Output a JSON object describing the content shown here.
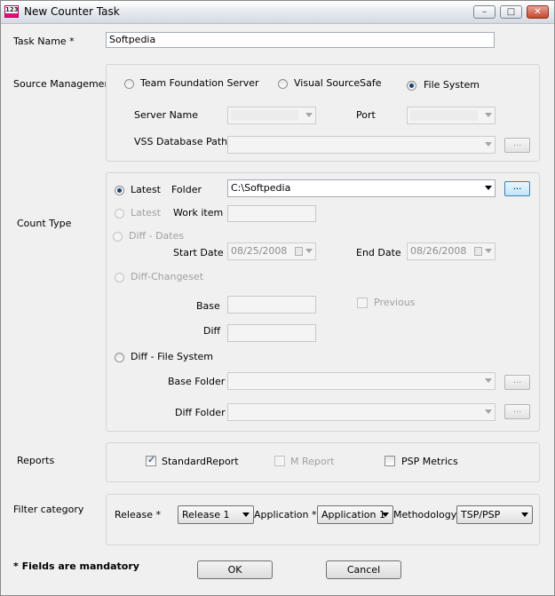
{
  "window": {
    "title": "New Counter Task",
    "icon_text": "123",
    "controls": {
      "minimize": "–",
      "maximize": "□",
      "close": "✕"
    }
  },
  "task_name": {
    "label": "Task Name *",
    "value": "Softpedia"
  },
  "source_management": {
    "label": "Source Management",
    "options": [
      "Team Foundation Server",
      "Visual SourceSafe",
      "File System"
    ],
    "selected": "File System",
    "server_name_label": "Server Name",
    "port_label": "Port",
    "vss_db_path_label": "VSS Database Path",
    "browse_label": "..."
  },
  "count_type": {
    "label": "Count Type",
    "latest_label": "Latest",
    "folder_label": "Folder",
    "folder_value": "C:\\Softpedia",
    "browse_label": "...",
    "latest_work_item_label": "Latest",
    "work_item_label": "Work item",
    "diff_dates_label": "Diff - Dates",
    "start_date_label": "Start Date",
    "start_date_value": "08/25/2008",
    "end_date_label": "End Date",
    "end_date_value": "08/26/2008",
    "diff_changeset_label": "Diff-Changeset",
    "base_label": "Base",
    "previous_label": "Previous",
    "diff_label": "Diff",
    "diff_file_system_label": "Diff - File System",
    "base_folder_label": "Base Folder",
    "diff_folder_label": "Diff Folder"
  },
  "reports": {
    "label": "Reports",
    "standard": {
      "label": "StandardReport",
      "checked": true
    },
    "m_report": {
      "label": "M Report",
      "checked": false
    },
    "psp": {
      "label": "PSP Metrics",
      "checked": false
    }
  },
  "filter": {
    "label": "Filter category",
    "release_label": "Release *",
    "release_value": "Release 1",
    "application_label": "Application *",
    "application_value": "Application 1",
    "methodology_label": "Methodology *",
    "methodology_value": "TSP/PSP"
  },
  "footer": {
    "mandatory_note": "* Fields are mandatory",
    "ok_label": "OK",
    "cancel_label": "Cancel"
  }
}
